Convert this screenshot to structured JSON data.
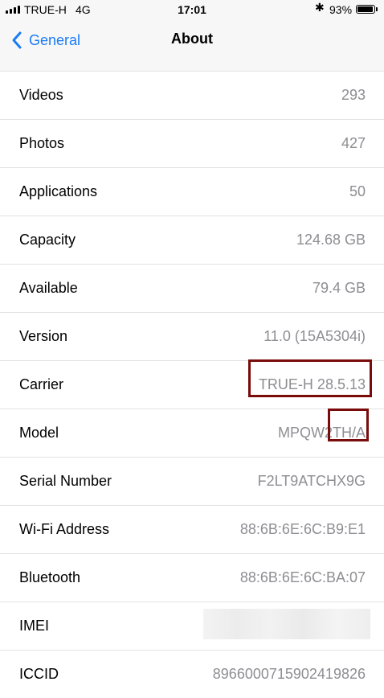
{
  "status_bar": {
    "carrier": "TRUE-H",
    "network": "4G",
    "time": "17:01",
    "bluetooth_icon": "bluetooth-icon",
    "battery_percent": "93%",
    "battery_level": 0.93
  },
  "nav": {
    "back_label": "General",
    "title": "About"
  },
  "rows": [
    {
      "label": "Videos",
      "value": "293"
    },
    {
      "label": "Photos",
      "value": "427"
    },
    {
      "label": "Applications",
      "value": "50"
    },
    {
      "label": "Capacity",
      "value": "124.68 GB"
    },
    {
      "label": "Available",
      "value": "79.4 GB"
    },
    {
      "label": "Version",
      "value": "11.0 (15A5304i)"
    },
    {
      "label": "Carrier",
      "value": "TRUE-H 28.5.13"
    },
    {
      "label": "Model",
      "value": "MPQW2TH/A"
    },
    {
      "label": "Serial Number",
      "value": "F2LT9ATCHX9G"
    },
    {
      "label": "Wi-Fi Address",
      "value": "88:6B:6E:6C:B9:E1"
    },
    {
      "label": "Bluetooth",
      "value": "88:6B:6E:6C:BA:07"
    },
    {
      "label": "IMEI",
      "value": ""
    },
    {
      "label": "ICCID",
      "value": "8966000715902419826"
    }
  ],
  "colors": {
    "accent": "#1a7cf5",
    "value_text": "#8e8e93",
    "highlight_box": "#7a0b0b"
  }
}
